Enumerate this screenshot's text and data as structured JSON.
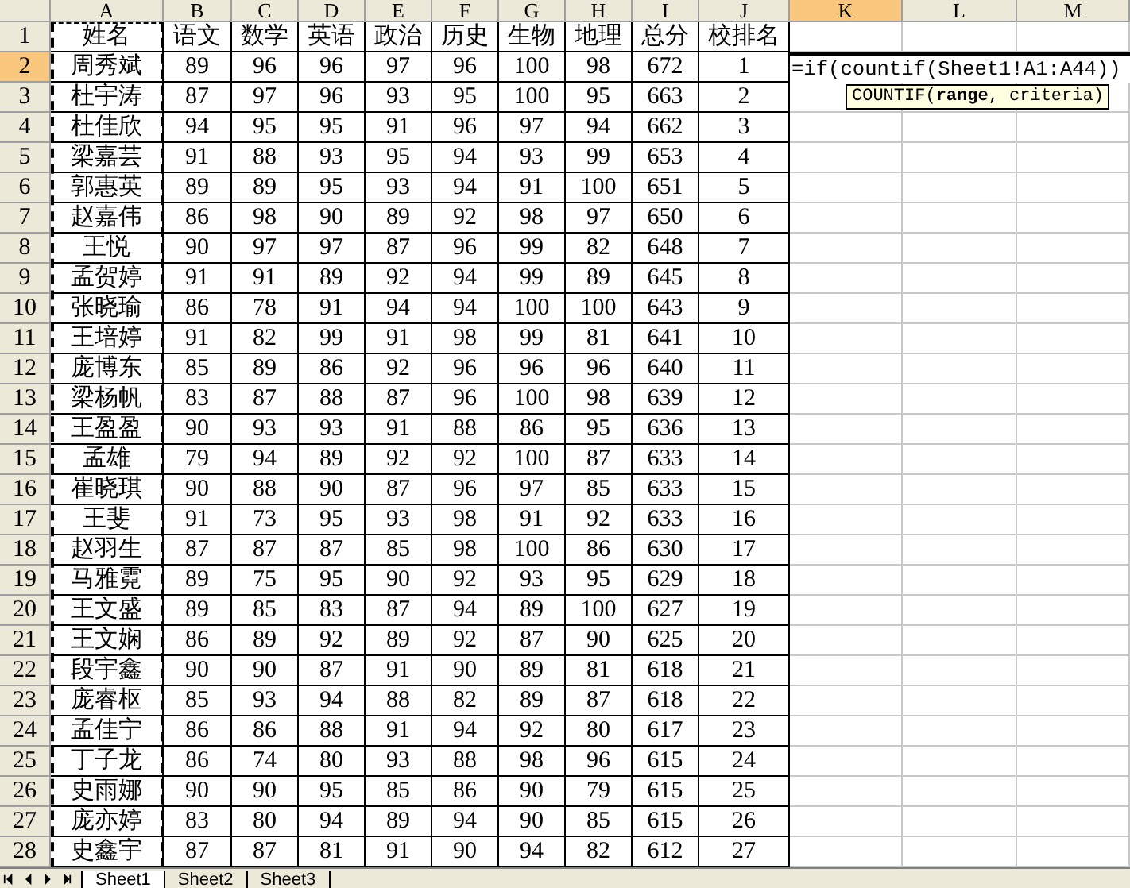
{
  "columns": [
    {
      "label": "A",
      "selected": false,
      "marquee": true
    },
    {
      "label": "B",
      "selected": false,
      "marquee": false
    },
    {
      "label": "C",
      "selected": false,
      "marquee": false
    },
    {
      "label": "D",
      "selected": false,
      "marquee": false
    },
    {
      "label": "E",
      "selected": false,
      "marquee": false
    },
    {
      "label": "F",
      "selected": false,
      "marquee": false
    },
    {
      "label": "G",
      "selected": false,
      "marquee": false
    },
    {
      "label": "H",
      "selected": false,
      "marquee": false
    },
    {
      "label": "I",
      "selected": false,
      "marquee": false
    },
    {
      "label": "J",
      "selected": false,
      "marquee": false
    },
    {
      "label": "K",
      "selected": true,
      "marquee": false
    },
    {
      "label": "L",
      "selected": false,
      "marquee": false
    },
    {
      "label": "M",
      "selected": false,
      "marquee": false
    }
  ],
  "rows": [
    {
      "number": "1",
      "selected": false,
      "cells": [
        "姓名",
        "语文",
        "数学",
        "英语",
        "政治",
        "历史",
        "生物",
        "地理",
        "总分",
        "校排名"
      ]
    },
    {
      "number": "2",
      "selected": true,
      "cells": [
        "周秀斌",
        "89",
        "96",
        "96",
        "97",
        "96",
        "100",
        "98",
        "672",
        "1"
      ]
    },
    {
      "number": "3",
      "selected": false,
      "cells": [
        "杜宇涛",
        "87",
        "97",
        "96",
        "93",
        "95",
        "100",
        "95",
        "663",
        "2"
      ]
    },
    {
      "number": "4",
      "selected": false,
      "cells": [
        "杜佳欣",
        "94",
        "95",
        "95",
        "91",
        "96",
        "97",
        "94",
        "662",
        "3"
      ]
    },
    {
      "number": "5",
      "selected": false,
      "cells": [
        "梁嘉芸",
        "91",
        "88",
        "93",
        "95",
        "94",
        "93",
        "99",
        "653",
        "4"
      ]
    },
    {
      "number": "6",
      "selected": false,
      "cells": [
        "郭惠英",
        "89",
        "89",
        "95",
        "93",
        "94",
        "91",
        "100",
        "651",
        "5"
      ]
    },
    {
      "number": "7",
      "selected": false,
      "cells": [
        "赵嘉伟",
        "86",
        "98",
        "90",
        "89",
        "92",
        "98",
        "97",
        "650",
        "6"
      ]
    },
    {
      "number": "8",
      "selected": false,
      "cells": [
        "王悦",
        "90",
        "97",
        "97",
        "87",
        "96",
        "99",
        "82",
        "648",
        "7"
      ]
    },
    {
      "number": "9",
      "selected": false,
      "cells": [
        "孟贺婷",
        "91",
        "91",
        "89",
        "92",
        "94",
        "99",
        "89",
        "645",
        "8"
      ]
    },
    {
      "number": "10",
      "selected": false,
      "cells": [
        "张晓瑜",
        "86",
        "78",
        "91",
        "94",
        "94",
        "100",
        "100",
        "643",
        "9"
      ]
    },
    {
      "number": "11",
      "selected": false,
      "cells": [
        "王培婷",
        "91",
        "82",
        "99",
        "91",
        "98",
        "99",
        "81",
        "641",
        "10"
      ]
    },
    {
      "number": "12",
      "selected": false,
      "cells": [
        "庞博东",
        "85",
        "89",
        "86",
        "92",
        "96",
        "96",
        "96",
        "640",
        "11"
      ]
    },
    {
      "number": "13",
      "selected": false,
      "cells": [
        "梁杨帆",
        "83",
        "87",
        "88",
        "87",
        "96",
        "100",
        "98",
        "639",
        "12"
      ]
    },
    {
      "number": "14",
      "selected": false,
      "cells": [
        "王盈盈",
        "90",
        "93",
        "93",
        "91",
        "88",
        "86",
        "95",
        "636",
        "13"
      ]
    },
    {
      "number": "15",
      "selected": false,
      "cells": [
        "孟雄",
        "79",
        "94",
        "89",
        "92",
        "92",
        "100",
        "87",
        "633",
        "14"
      ]
    },
    {
      "number": "16",
      "selected": false,
      "cells": [
        "崔晓琪",
        "90",
        "88",
        "90",
        "87",
        "96",
        "97",
        "85",
        "633",
        "15"
      ]
    },
    {
      "number": "17",
      "selected": false,
      "cells": [
        "王斐",
        "91",
        "73",
        "95",
        "93",
        "98",
        "91",
        "92",
        "633",
        "16"
      ]
    },
    {
      "number": "18",
      "selected": false,
      "cells": [
        "赵羽生",
        "87",
        "87",
        "87",
        "85",
        "98",
        "100",
        "86",
        "630",
        "17"
      ]
    },
    {
      "number": "19",
      "selected": false,
      "cells": [
        "马雅霓",
        "89",
        "75",
        "95",
        "90",
        "92",
        "93",
        "95",
        "629",
        "18"
      ]
    },
    {
      "number": "20",
      "selected": false,
      "cells": [
        "王文盛",
        "89",
        "85",
        "83",
        "87",
        "94",
        "89",
        "100",
        "627",
        "19"
      ]
    },
    {
      "number": "21",
      "selected": false,
      "cells": [
        "王文娴",
        "86",
        "89",
        "92",
        "89",
        "92",
        "87",
        "90",
        "625",
        "20"
      ]
    },
    {
      "number": "22",
      "selected": false,
      "cells": [
        "段宇鑫",
        "90",
        "90",
        "87",
        "91",
        "90",
        "89",
        "81",
        "618",
        "21"
      ]
    },
    {
      "number": "23",
      "selected": false,
      "cells": [
        "庞睿枢",
        "85",
        "93",
        "94",
        "88",
        "82",
        "89",
        "87",
        "618",
        "22"
      ]
    },
    {
      "number": "24",
      "selected": false,
      "cells": [
        "孟佳宁",
        "86",
        "86",
        "88",
        "91",
        "94",
        "92",
        "80",
        "617",
        "23"
      ]
    },
    {
      "number": "25",
      "selected": false,
      "cells": [
        "丁子龙",
        "86",
        "74",
        "80",
        "93",
        "88",
        "98",
        "96",
        "615",
        "24"
      ]
    },
    {
      "number": "26",
      "selected": false,
      "cells": [
        "史雨娜",
        "90",
        "90",
        "95",
        "85",
        "86",
        "90",
        "79",
        "615",
        "25"
      ]
    },
    {
      "number": "27",
      "selected": false,
      "cells": [
        "庞亦婷",
        "83",
        "80",
        "94",
        "89",
        "94",
        "90",
        "85",
        "615",
        "26"
      ]
    },
    {
      "number": "28",
      "selected": false,
      "cells": [
        "史鑫宇",
        "87",
        "87",
        "81",
        "91",
        "90",
        "94",
        "82",
        "612",
        "27"
      ]
    }
  ],
  "formula_entry": {
    "text": "=if(countif(Sheet1!A1:A44))",
    "tooltip": "COUNTIF(**range**, criteria)"
  },
  "sheet_tabs": [
    {
      "label": "Sheet1",
      "selected": true
    },
    {
      "label": "Sheet2",
      "selected": false
    },
    {
      "label": "Sheet3",
      "selected": false
    }
  ]
}
